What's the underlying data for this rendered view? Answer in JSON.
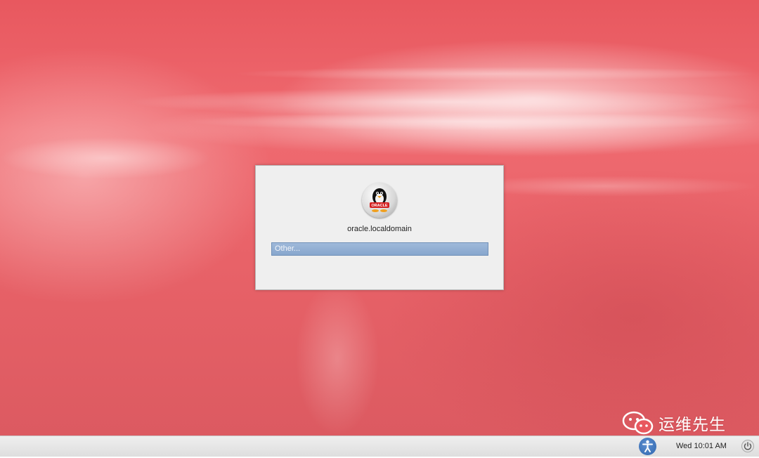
{
  "login": {
    "hostname": "oracle.localdomain",
    "user_list": [
      {
        "label": "Other..."
      }
    ],
    "logo_text": "ORACLE"
  },
  "panel": {
    "clock": "Wed 10:01 AM",
    "accessibility_icon": "accessibility-icon",
    "power_icon": "power-icon"
  },
  "watermark": {
    "text": "运维先生",
    "icon": "wechat-icon"
  },
  "colors": {
    "background_accent": "#e8585f",
    "dialog_bg": "#efefef",
    "selected_item_bg": "#8eabd2",
    "panel_bg": "#e8e8e8",
    "accessibility_blue": "#2f66ae"
  }
}
